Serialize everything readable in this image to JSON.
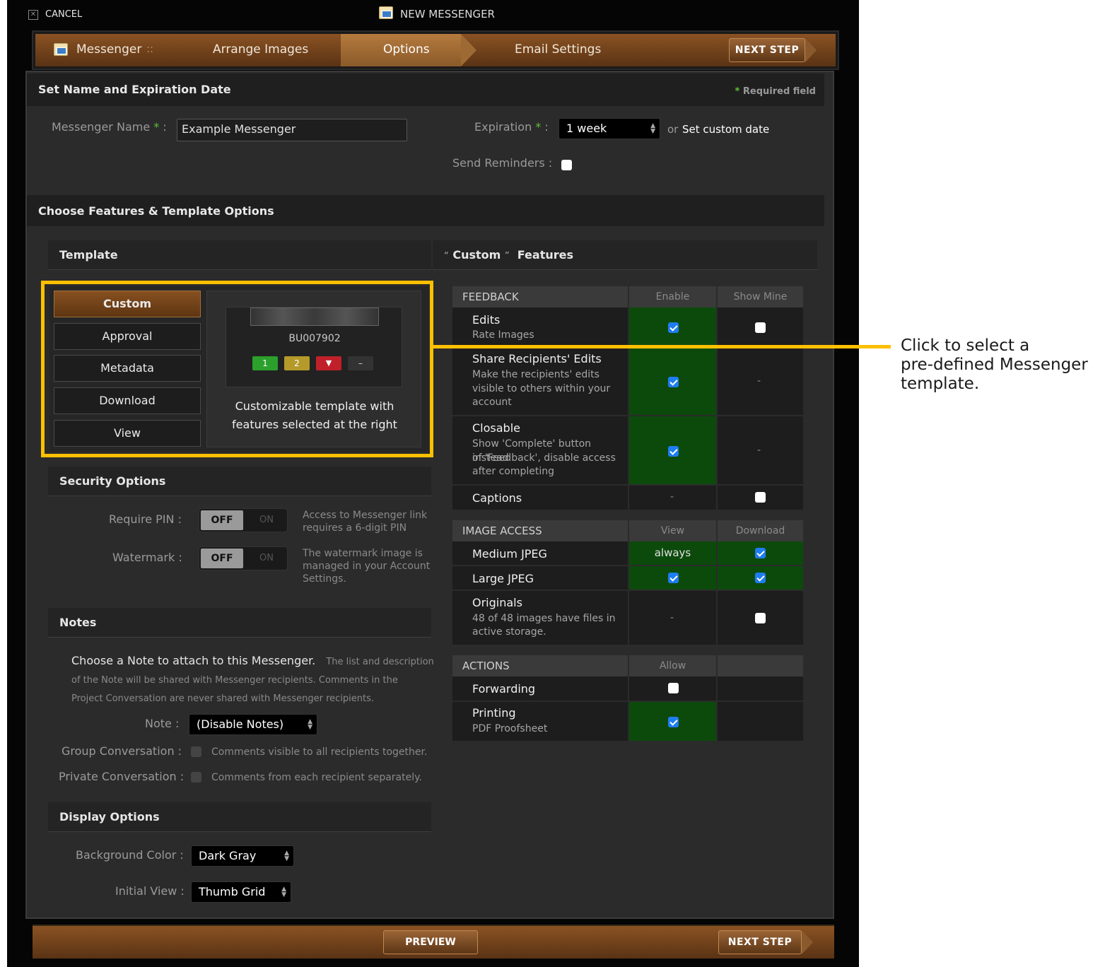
{
  "topbar": {
    "cancel_label": "CANCEL",
    "title": "NEW MESSENGER"
  },
  "wizard": {
    "messenger_label": "Messenger",
    "separator": "::",
    "steps": [
      "Arrange Images",
      "Options",
      "Email Settings"
    ],
    "active_step": "Options",
    "next_label": "NEXT STEP"
  },
  "name_section": {
    "title": "Set Name and Expiration Date",
    "required_note": "Required field",
    "name_label": "Messenger Name",
    "name_value": "Example Messenger",
    "expiration_label": "Expiration",
    "expiration_value": "1 week",
    "or_text": "or",
    "custom_date_link": "Set custom date",
    "reminders_label": "Send Reminders :",
    "reminders_checked": false
  },
  "features_section": {
    "title": "Choose Features & Template Options"
  },
  "template": {
    "title": "Template",
    "options": [
      "Custom",
      "Approval",
      "Metadata",
      "Download",
      "View"
    ],
    "selected": "Custom",
    "preview_id": "BU007902",
    "preview_badges": [
      "1",
      "2",
      "",
      "–"
    ],
    "description_line1": "Customizable template with",
    "description_line2": "features selected at the right"
  },
  "custom_features": {
    "title_quote_open": "“",
    "title_name": "Custom",
    "title_quote_close": "”",
    "title_suffix": "Features"
  },
  "feedback": {
    "header": "FEEDBACK",
    "col1": "Enable",
    "col2": "Show Mine",
    "rows": [
      {
        "name": "Edits",
        "desc": "Rate Images"
      },
      {
        "name": "Share Recipients' Edits",
        "desc1": "Make the recipients' edits",
        "desc2": "visible to others within your",
        "desc3": "account"
      },
      {
        "name": "Closable",
        "desc1": "Show 'Complete' button instead",
        "desc2": "of 'Feedback', disable access",
        "desc3": "after completing"
      },
      {
        "name": "Captions"
      }
    ],
    "dash": "-"
  },
  "image_access": {
    "header": "IMAGE ACCESS",
    "col1": "View",
    "col2": "Download",
    "rows": [
      {
        "name": "Medium JPEG",
        "view": "always"
      },
      {
        "name": "Large JPEG"
      },
      {
        "name": "Originals",
        "desc1": "48 of 48 images have files in",
        "desc2": "active storage."
      }
    ]
  },
  "actions": {
    "header": "ACTIONS",
    "col1": "Allow",
    "rows": [
      {
        "name": "Forwarding"
      },
      {
        "name": "Printing",
        "desc": "PDF Proofsheet"
      }
    ]
  },
  "security": {
    "title": "Security Options",
    "pin_label": "Require PIN :",
    "pin_help1": "Access to Messenger link",
    "pin_help2": "requires a 6-digit PIN",
    "watermark_label": "Watermark :",
    "wm_help1": "The watermark image is",
    "wm_help2": "managed in your Account",
    "wm_help3": "Settings.",
    "off": "OFF",
    "on": "ON"
  },
  "notes": {
    "title": "Notes",
    "intro": "Choose a Note to attach to this Messenger.",
    "intro_small": "The list and description",
    "line2": "of the Note will be shared with Messenger recipients. Comments in the",
    "line3": "Project Conversation are never shared with Messenger recipients.",
    "note_label": "Note :",
    "note_value": "(Disable Notes)",
    "group_label": "Group Conversation :",
    "group_help": "Comments visible to all recipients together.",
    "private_label": "Private Conversation :",
    "private_help": "Comments from each recipient separately."
  },
  "display": {
    "title": "Display Options",
    "bg_label": "Background Color :",
    "bg_value": "Dark Gray",
    "view_label": "Initial View :",
    "view_value": "Thumb Grid"
  },
  "footer": {
    "preview_label": "PREVIEW",
    "next_label": "NEXT STEP"
  },
  "callout": {
    "line1": "Click to select a",
    "line2": "pre-defined Messenger",
    "line3": "template."
  },
  "colors": {
    "accent_highlight": "#ffc000",
    "enabled_green": "#0c4a0c",
    "brand_brown": "#8a5223"
  }
}
